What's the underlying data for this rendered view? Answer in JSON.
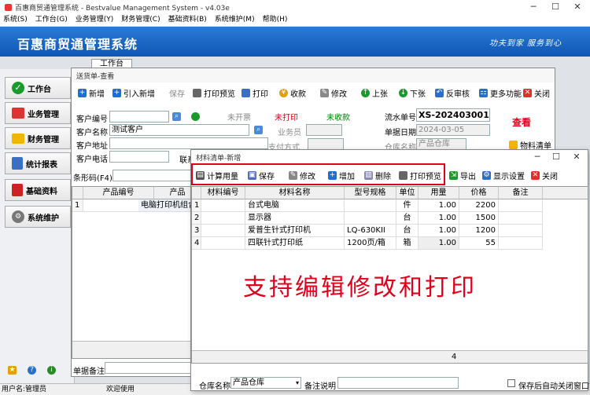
{
  "app": {
    "title": "百惠商贸通管理系统 - Bestvalue Management System - v4.03e",
    "menu": [
      "系统(S)",
      "工作台(G)",
      "业务管理(Y)",
      "财务管理(C)",
      "基础资料(B)",
      "系统维护(M)",
      "帮助(H)"
    ],
    "banner_title": "百惠商贸通管理系统",
    "slogan": "功夫到家 服务到心",
    "workbench_tab": "工作台"
  },
  "sidebar": {
    "items": [
      {
        "label": "工作台",
        "icon": "check-icon"
      },
      {
        "label": "业务管理",
        "icon": "house-icon"
      },
      {
        "label": "财务管理",
        "icon": "folder-icon"
      },
      {
        "label": "统计报表",
        "icon": "report-icon"
      },
      {
        "label": "基础资料",
        "icon": "book-icon"
      },
      {
        "label": "系统维护",
        "icon": "gear-icon"
      }
    ]
  },
  "status": {
    "user": "用户名:管理员",
    "welcome": "欢迎使用"
  },
  "order": {
    "title": "送货单-查看",
    "toolbar": [
      "新增",
      "引入新增",
      "保存",
      "打印预览",
      "打印",
      "收款",
      "修改",
      "上张",
      "下张",
      "反审核",
      "更多功能",
      "关闭"
    ],
    "customer_no_label": "客户编号",
    "customer_name_label": "客户名称",
    "customer_name_value": "测试客户",
    "address_label": "客户地址",
    "phone_label": "客户电话",
    "contact_label": "联系",
    "status_invoice": "未开票",
    "status_print": "未打印",
    "status_payment": "未收款",
    "salesman_label": "业务员",
    "payment_label": "支付方式",
    "serial_label": "流水单号",
    "serial_value": "XS-202403001",
    "date_label": "单据日期",
    "date_value": "2024-03-05",
    "warehouse_label": "仓库名称",
    "warehouse_value": "产品仓库",
    "view_label": "查看",
    "materials_btn": "物料清单",
    "barcode_label": "条形码(F4)",
    "columns": [
      "产品编号",
      "产品"
    ],
    "rows": [
      {
        "no": "1",
        "name": "电脑打印机组合"
      }
    ],
    "remark_label": "单据备注"
  },
  "materials": {
    "title": "材料清单-新增",
    "toolbar": [
      "计算用量",
      "保存",
      "修改",
      "增加",
      "删除",
      "打印预览",
      "导出",
      "显示设置",
      "关闭"
    ],
    "columns": [
      "材料编号",
      "材料名称",
      "型号规格",
      "单位",
      "用量",
      "价格",
      "备注"
    ],
    "rows": [
      {
        "no": "1",
        "code": "",
        "name": "台式电脑",
        "spec": "",
        "unit": "件",
        "qty": "1.00",
        "price": "2200",
        "note": ""
      },
      {
        "no": "2",
        "code": "",
        "name": "显示器",
        "spec": "",
        "unit": "台",
        "qty": "1.00",
        "price": "1500",
        "note": ""
      },
      {
        "no": "3",
        "code": "",
        "name": "爱普生针式打印机",
        "spec": "LQ-630KII",
        "unit": "台",
        "qty": "1.00",
        "price": "1200",
        "note": ""
      },
      {
        "no": "4",
        "code": "",
        "name": "四联针式打印纸",
        "spec": "1200页/箱",
        "unit": "箱",
        "qty": "1.00",
        "price": "55",
        "note": ""
      }
    ],
    "row_count": "4",
    "promo_text": "支持编辑修改和打印",
    "warehouse_label": "仓库名称",
    "warehouse_value": "产品仓库",
    "remark_label": "备注说明",
    "autoclose_label": "保存后自动关闭窗口"
  },
  "colors": {
    "banner": "#1565c9",
    "accent_red": "#e0001b",
    "status_green": "#008000",
    "highlight_box": "#e0001b"
  }
}
